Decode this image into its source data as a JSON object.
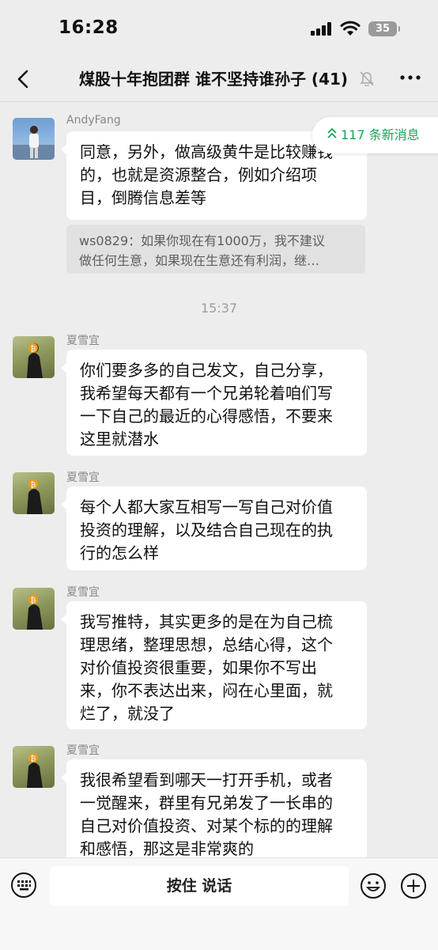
{
  "status_bar": {
    "time": "16:28",
    "battery": "35"
  },
  "header": {
    "title": "煤股十年抱团群 谁不坚持谁孙子 (41)"
  },
  "new_messages": {
    "label": "117 条新消息"
  },
  "messages": [
    {
      "sender": "AndyFang",
      "text": "同意，另外，做高级黄牛是比较赚钱\n的，也就是资源整合，例如介绍项\n目，倒腾信息差等",
      "quote": "ws0829：如果你现在有1000万，我不建议\n做任何生意，如果现在生意还有利润，继…"
    },
    {
      "sender": "夏雪宜",
      "text": "你们要多多的自己发文，自己分享，\n我希望每天都有一个兄弟轮着咱们写\n一下自己的最近的心得感悟，不要来\n这里就潜水"
    },
    {
      "sender": "夏雪宜",
      "text": "每个人都大家互相写一写自己对价值\n投资的理解，以及结合自己现在的执\n行的怎么样"
    },
    {
      "sender": "夏雪宜",
      "text": "我写推特，其实更多的是在为自己梳\n理思绪，整理思想，总结心得，这个\n对价值投资很重要，如果你不写出\n来，你不表达出来，闷在心里面，就\n烂了，就没了"
    },
    {
      "sender": "夏雪宜",
      "text": "我很希望看到哪天一打开手机，或者\n一觉醒来，群里有兄弟发了一长串的\n自己对价值投资、对某个标的的理解\n和感悟，那这是非常爽的"
    }
  ],
  "timestamp": "15:37",
  "input": {
    "hold_to_talk": "按住 说话"
  },
  "colors": {
    "accent_green": "#19a45a",
    "background": "#ededed",
    "bubble": "#ffffff"
  }
}
